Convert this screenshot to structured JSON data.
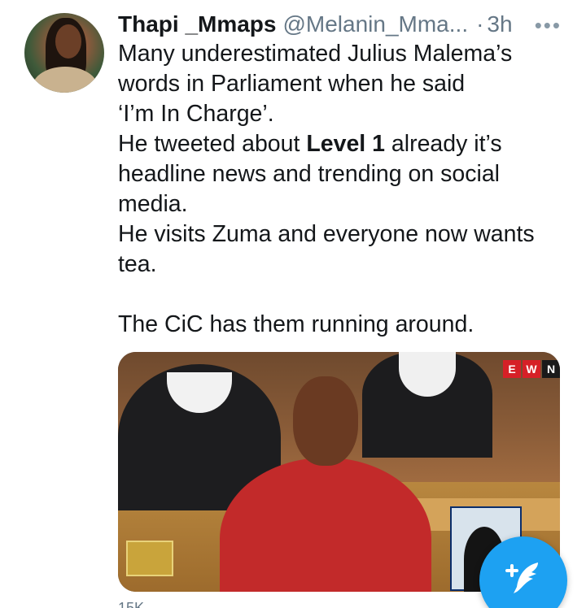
{
  "tweet": {
    "display_name": "Thapi _Mmaps",
    "handle": "@Melanin_Mma...",
    "separator": "·",
    "time": "3h",
    "more": "•••",
    "avatar_icon": "profile-photo",
    "lines": {
      "l1": "Many underestimated Julius Malema’s",
      "l2": "words in Parliament when he said",
      "l3": "‘I’m In Charge’.",
      "l4_pre": "He tweeted about ",
      "l4_bold": "Level 1",
      "l4_post": " already it’s",
      "l5": "headline news and trending on social",
      "l6": "media.",
      "l7": "He visits Zuma and everyone now wants",
      "l8": "tea.",
      "l9": "The CiC has them running around."
    },
    "media": {
      "type": "video-thumbnail",
      "ewn_badge": [
        "E",
        "W",
        "N"
      ]
    },
    "stats_peek": "15K"
  },
  "compose_fab": {
    "icon": "compose-feather-plus-icon",
    "color": "#1da1f2"
  }
}
